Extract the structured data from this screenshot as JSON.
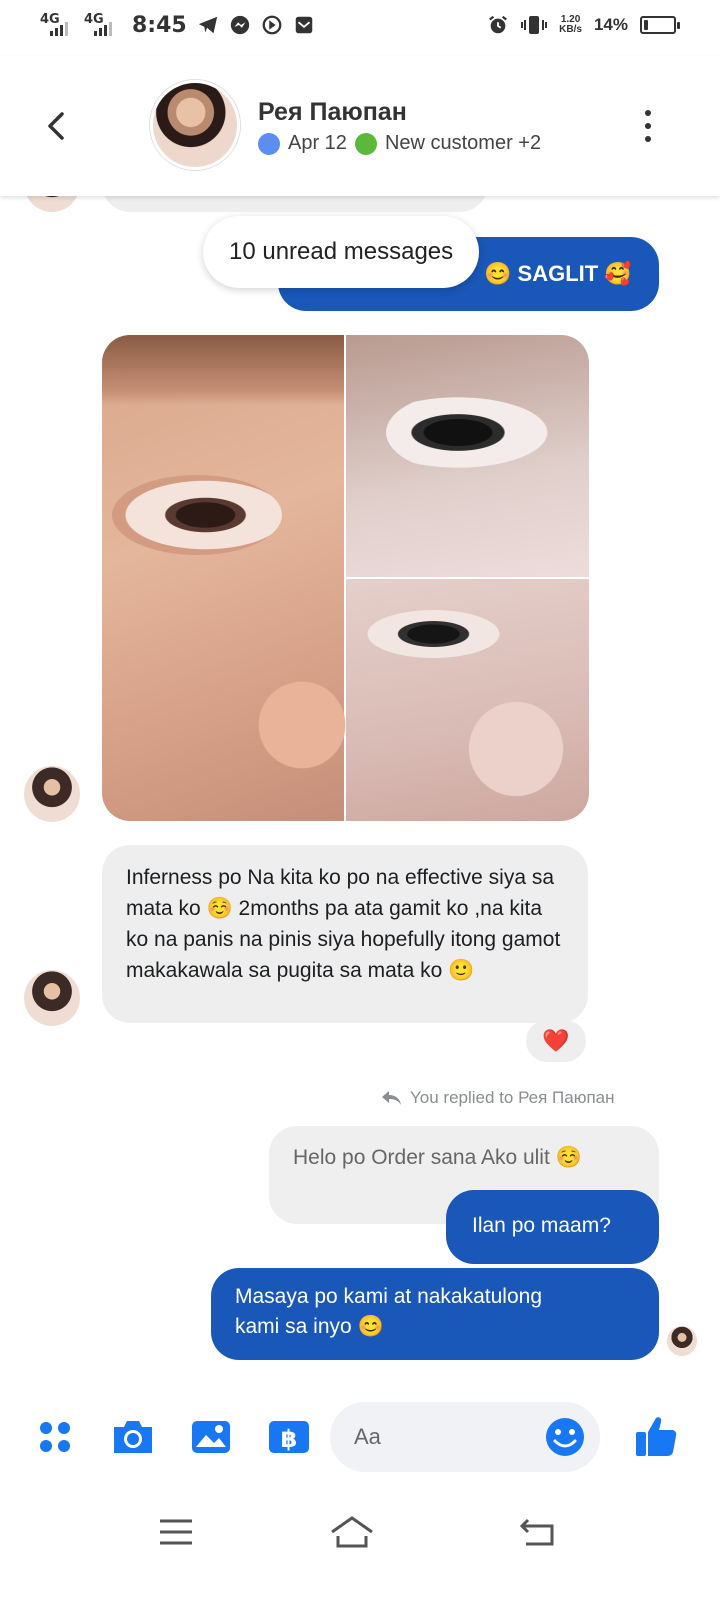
{
  "status_bar": {
    "network1": "4G",
    "network2": "4G",
    "time": "8:45",
    "net_speed_value": "1.20",
    "net_speed_unit": "KB/s",
    "battery_percent": "14%",
    "battery_level": 0.14
  },
  "header": {
    "contact_name": "Рея Паюпан",
    "tags": [
      {
        "label": "Apr 12",
        "color": "#5b8ef0"
      },
      {
        "label": "New customer +2",
        "color": "#5cb83a"
      }
    ]
  },
  "thread": {
    "unread_banner": "10 unread messages",
    "outgoing_partial": "SAGLIT",
    "incoming_message": "Inferness po Na kita ko po na effective siya sa mata ko ☺️ 2months pa ata gamit ko  ,na kita ko na panis na pinis siya hopefully itong gamot makakawala sa pugita sa mata ko 🙂",
    "reaction": "❤️",
    "reply_note": "You replied to Рея Паюпан",
    "quoted_message": "Helo po Order sana Ako ulit ☺️",
    "outgoing_1": "Ilan po maam?",
    "outgoing_2_line1": "Masaya po kami at nakakatulong",
    "outgoing_2_line2": "kami sa inyo 😊"
  },
  "composer": {
    "placeholder": "Aa",
    "value": "",
    "accent_color": "#1877f2"
  },
  "icons": {
    "composer": [
      "apps-icon",
      "camera-icon",
      "gallery-icon",
      "payment-icon",
      "emoji-icon",
      "thumbs-up-icon"
    ],
    "navbar": [
      "menu-icon",
      "home-icon",
      "back-icon"
    ]
  }
}
